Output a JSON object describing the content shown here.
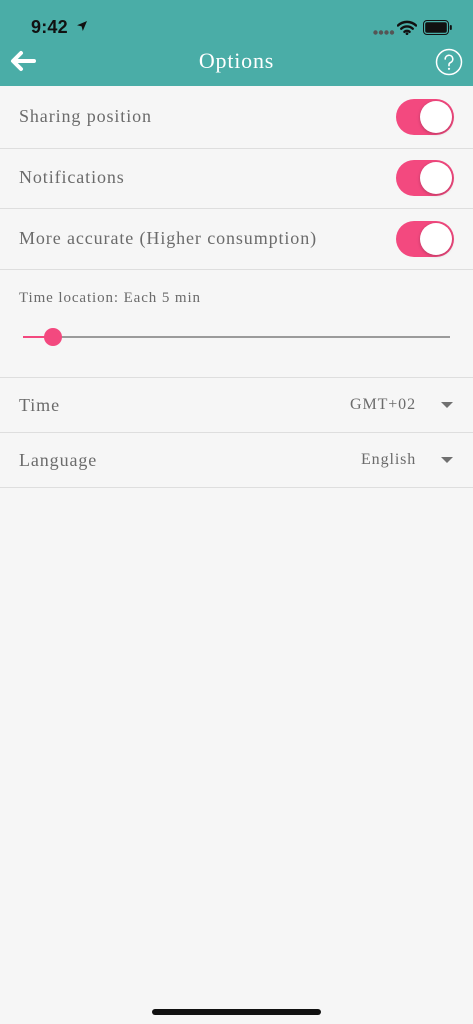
{
  "status_bar": {
    "time": "9:42",
    "icons": [
      "location-arrow-icon",
      "cellular-signal-icon",
      "wifi-icon",
      "battery-icon"
    ]
  },
  "nav": {
    "title": "Options",
    "back_icon": "arrow-left-icon",
    "help_icon": "question-circle-icon"
  },
  "settings": {
    "sharing_position": {
      "label": "Sharing position",
      "enabled": true
    },
    "notifications": {
      "label": "Notifications",
      "enabled": true
    },
    "more_accurate": {
      "label": "More accurate (Higher consumption)",
      "enabled": true
    },
    "time_location": {
      "label": "Time location: Each 5 min",
      "slider_fraction": 0.07
    },
    "time": {
      "label": "Time",
      "value": "GMT+02"
    },
    "language": {
      "label": "Language",
      "value": "English"
    }
  },
  "colors": {
    "header": "#4aada7",
    "accent": "#f3497f",
    "background": "#f6f6f6",
    "text": "#6b6b6b",
    "divider": "#dedede"
  }
}
